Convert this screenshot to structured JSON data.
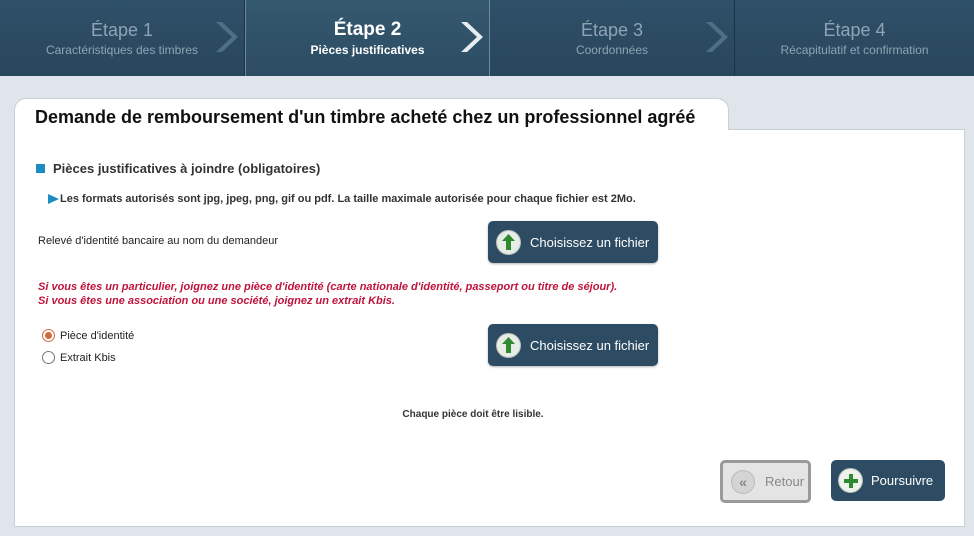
{
  "stepper": [
    {
      "title": "Étape 1",
      "subtitle": "Caractéristiques des timbres"
    },
    {
      "title": "Étape 2",
      "subtitle": "Pièces justificatives"
    },
    {
      "title": "Étape 3",
      "subtitle": "Coordonnées"
    },
    {
      "title": "Étape 4",
      "subtitle": "Récapitulatif et confirmation"
    }
  ],
  "page": {
    "title": "Demande de remboursement d'un timbre acheté chez un professionnel agréé"
  },
  "section": {
    "title": "Pièces justificatives à joindre (obligatoires)",
    "formats_info": "Les formats autorisés sont jpg, jpeg, png, gif ou pdf. La taille maximale autorisée pour chaque fichier est 2Mo."
  },
  "rib": {
    "label": "Relevé d'identité bancaire au nom du demandeur",
    "button": "Choisissez un fichier"
  },
  "warning": {
    "line1": "Si vous êtes un particulier, joignez une pièce d'identité (carte nationale d'identité, passeport ou titre de séjour).",
    "line2": "Si vous êtes une association ou une société, joignez un extrait Kbis."
  },
  "identity": {
    "options": [
      {
        "label": "Pièce d'identité",
        "selected": true
      },
      {
        "label": "Extrait Kbis",
        "selected": false
      }
    ],
    "button": "Choisissez un fichier"
  },
  "note": "Chaque pièce doit être lisible.",
  "actions": {
    "back": "Retour",
    "next": "Poursuivre"
  },
  "colors": {
    "primary": "#2d4c63",
    "accent": "#1c8cc0",
    "warning": "#c0143c",
    "radio_selected": "#d06c3a"
  }
}
